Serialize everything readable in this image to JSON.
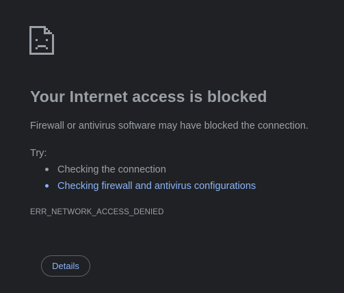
{
  "icon": "sad-page-icon",
  "heading": "Your Internet access is blocked",
  "description": "Firewall or antivirus software may have blocked the connection.",
  "try_label": "Try:",
  "suggestions": {
    "items": [
      {
        "label": "Checking the connection",
        "is_link": false
      },
      {
        "label": "Checking firewall and antivirus configurations",
        "is_link": true
      }
    ]
  },
  "error_code": "ERR_NETWORK_ACCESS_DENIED",
  "details_button": "Details",
  "colors": {
    "background": "#202124",
    "text": "#9aa0a6",
    "link": "#8ab4f8",
    "button_border": "#5f6368"
  }
}
